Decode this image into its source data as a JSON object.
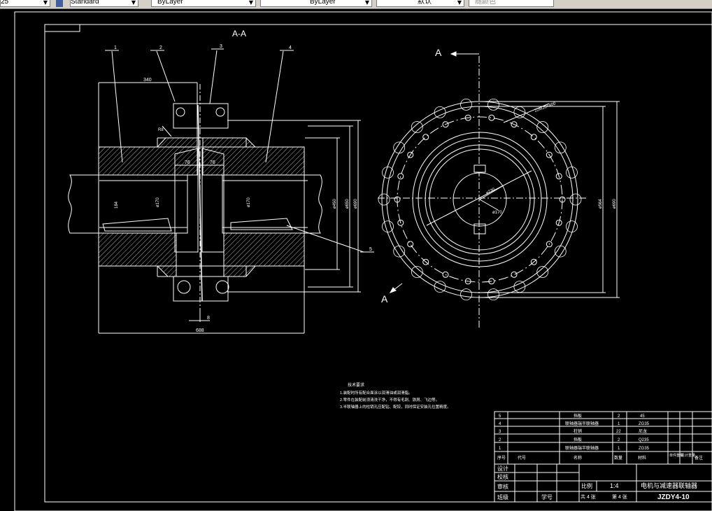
{
  "toolbar": {
    "left_fragment": "25",
    "text_style": "Standard",
    "layer_combo": "ByLayer",
    "linetype_combo": "ByLayer",
    "lineweight_combo": "默认",
    "plotstyle_combo": "随颜色"
  },
  "drawing": {
    "section_label": "A-A",
    "view_arrow_label": "A",
    "view_arrow_label2": "A",
    "part_leaders": [
      "1",
      "2",
      "3",
      "4",
      "5"
    ],
    "dims": {
      "d340": "340",
      "d688": "688",
      "d8": "8",
      "d76a": "76",
      "d76b": "76",
      "r8": "R8",
      "d184": "184",
      "d450": "ø450",
      "d650": "ø650",
      "d690": "ø690",
      "d564": "ø564",
      "d170": "ø170",
      "d230": "ø230",
      "d400": "ø400",
      "d180": "ø180",
      "d170b": "ø170",
      "d6h7": "ø170",
      "bolt": "22M20×400"
    }
  },
  "notes": {
    "title": "技术要求",
    "lines": [
      "1.装配时所有配合面涂以润滑油或润滑脂。",
      "2.零件在装配前须清洗干净，不得有毛刺、铁屑、飞边等。",
      "3.半联轴器上的柱销孔应配钻、配铰，同时保证安装孔位置精度。"
    ]
  },
  "bom": {
    "rows": [
      {
        "no": "5",
        "code": "",
        "name": "挡板",
        "qty": "2",
        "material": "45",
        "unit": "",
        "total": "",
        "note": ""
      },
      {
        "no": "4",
        "code": "",
        "name": "联轴器端半联轴器",
        "qty": "1",
        "material": "ZG35",
        "unit": "",
        "total": "",
        "note": ""
      },
      {
        "no": "3",
        "code": "",
        "name": "柱销",
        "qty": "22",
        "material": "尼龙",
        "unit": "",
        "total": "",
        "note": ""
      },
      {
        "no": "2",
        "code": "",
        "name": "挡板",
        "qty": "2",
        "material": "Q235",
        "unit": "",
        "total": "",
        "note": ""
      },
      {
        "no": "1",
        "code": "",
        "name": "联轴器端半联轴器",
        "qty": "1",
        "material": "ZG35",
        "unit": "",
        "total": "",
        "note": ""
      }
    ],
    "header": {
      "no": "序号",
      "code": "代号",
      "name": "名称",
      "qty": "数量",
      "material": "材料",
      "unit": "单件重量",
      "total": "总计重量",
      "note": "备注"
    }
  },
  "title_block": {
    "design": "设计",
    "check": "校核",
    "review": "审核",
    "class": "班级",
    "student_no": "学号",
    "scale_label": "比例",
    "scale": "1:4",
    "drawing_name": "电机与减速器联轴器",
    "total_sheets": "共 4 张",
    "sheet_no": "第 4 张",
    "drawing_code": "JZDY4-10"
  },
  "colors": {
    "background": "#000000",
    "lines": "#ffffff",
    "toolbar": "#d4d0c8"
  }
}
